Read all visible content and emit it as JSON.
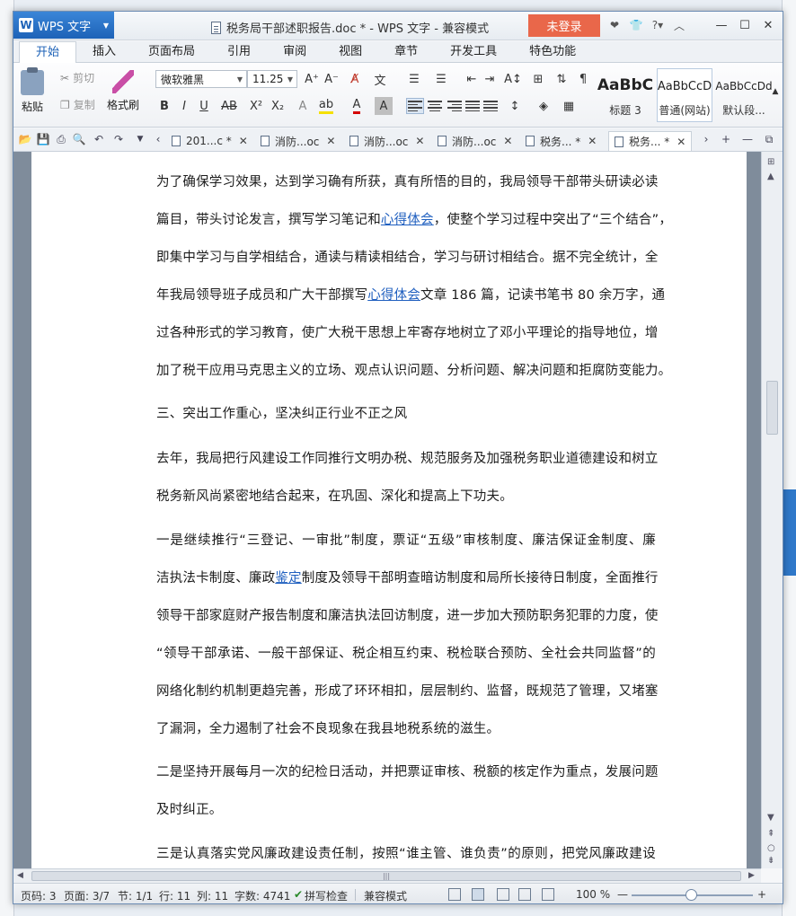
{
  "window": {
    "app_button": "WPS 文字",
    "title": "税务局干部述职报告.doc * - WPS 文字 - 兼容模式",
    "login": "未登录"
  },
  "ribbon_tabs": [
    "开始",
    "插入",
    "页面布局",
    "引用",
    "审阅",
    "视图",
    "章节",
    "开发工具",
    "特色功能"
  ],
  "ribbon": {
    "paste": "粘贴",
    "cut": "剪切",
    "copy": "复制",
    "format_painter": "格式刷",
    "font_name": "微软雅黑",
    "font_size": "11.25",
    "styles": [
      {
        "preview": "AaBbC",
        "caption": "标题 3"
      },
      {
        "preview": "AaBbCcD",
        "caption": "普通(网站)"
      },
      {
        "preview": "AaBbCcDd",
        "caption": "默认段..."
      }
    ]
  },
  "doc_tabs": [
    {
      "label": "201...c *",
      "active": false
    },
    {
      "label": "消防...oc",
      "active": false
    },
    {
      "label": "消防...oc",
      "active": false
    },
    {
      "label": "消防...oc",
      "active": false
    },
    {
      "label": "税务... *",
      "active": false
    },
    {
      "label": "税务... *",
      "active": true
    }
  ],
  "document": {
    "p1": [
      "为了确保学习效果，达到学习确有所获，真有所悟的目的，我局领导干部带头研读必读",
      [
        "篇目，带头讨论发言，撰写学习笔记和",
        "心得体会",
        "，使整个学习过程中突出了“三个结合”，"
      ],
      "即集中学习与自学相结合，通读与精读相结合，学习与研讨相结合。据不完全统计，全",
      [
        "年我局领导班子成员和广大干部撰写",
        "心得体会",
        "文章 186 篇，记读书笔书 80 余万字，通"
      ],
      "过各种形式的学习教育，使广大税干思想上牢寄存地树立了邓小平理论的指导地位，增",
      "加了税干应用马克思主义的立场、观点认识问题、分析问题、解决问题和拒腐防变能力。"
    ],
    "heading3": "三、突出工作重心，坚决纠正行业不正之风",
    "p2": [
      "去年，我局把行风建设工作同推行文明办税、规范服务及加强税务职业道德建设和树立",
      "税务新风尚紧密地结合起来，在巩固、深化和提高上下功夫。"
    ],
    "p3": [
      "一是继续推行“三登记、一审批”制度，票证“五级”审核制度、廉洁保证金制度、廉",
      [
        "洁执法卡制度、廉政",
        "鉴定",
        "制度及领导干部明查暗访制度和局所长接待日制度，全面推行"
      ],
      "领导干部家庭财产报告制度和廉洁执法回访制度，进一步加大预防职务犯罪的力度，使",
      "“领导干部承诺、一般干部保证、税企相互约束、税检联合预防、全社会共同监督”的",
      "网络化制约机制更趋完善，形成了环环相扣，层层制约、监督，既规范了管理，又堵塞",
      "了漏洞，全力遏制了社会不良现象在我县地税系统的滋生。"
    ],
    "p4": [
      "二是坚持开展每月一次的纪检日活动，并把票证审核、税额的核定作为重点，发展问题",
      "及时纠正。"
    ],
    "p5": [
      "三是认真落实党风廉政建设责任制，按照“谁主管、谁负责”的原则，把党风廉政建设"
    ]
  },
  "status": {
    "page_code": "页码: 3",
    "pages": "页面: 3/7",
    "section": "节: 1/1",
    "row": "行: 11",
    "col": "列: 11",
    "words": "字数: 4741",
    "spell": "拼写检查",
    "mode": "兼容模式",
    "zoom": "100 %"
  },
  "colors": {
    "accent": "#1d62b7",
    "login": "#e9674a",
    "link": "#1f5fbf"
  }
}
